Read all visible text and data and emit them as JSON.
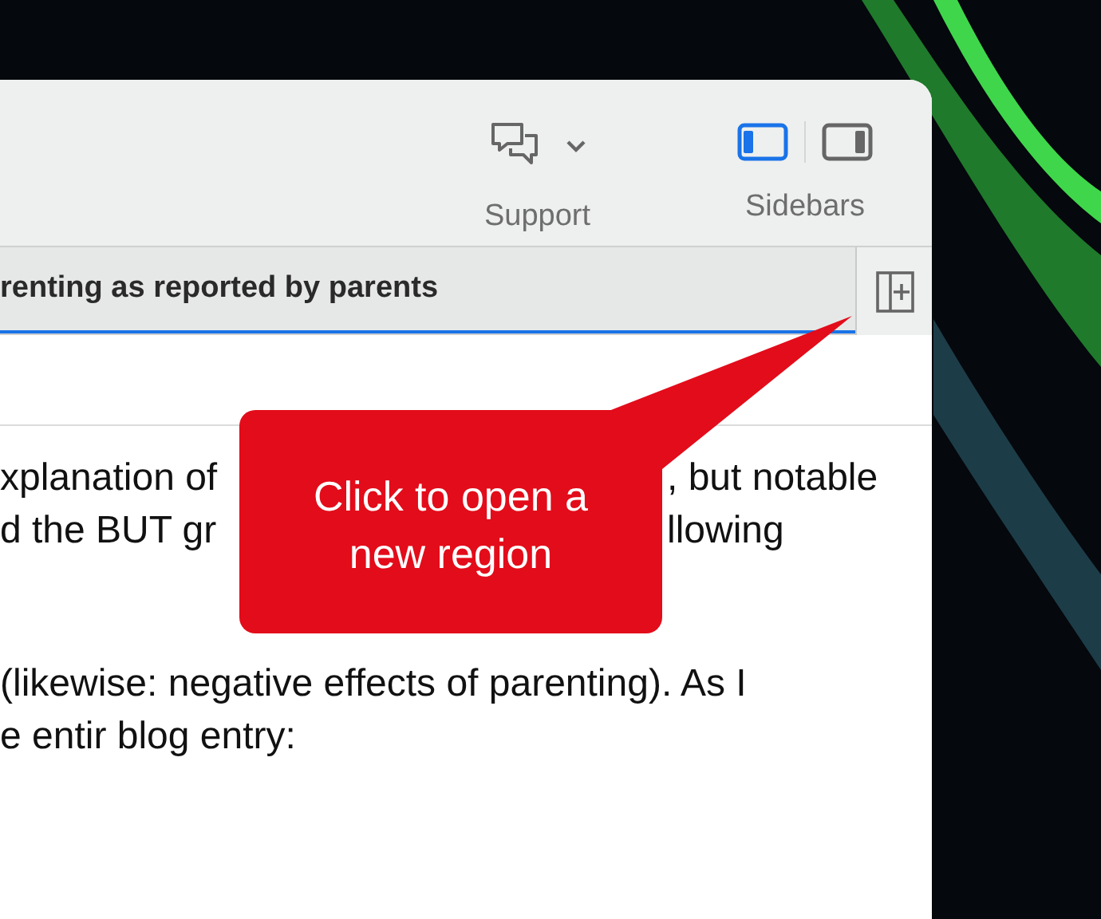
{
  "toolbar": {
    "support": {
      "label": "Support"
    },
    "sidebars": {
      "label": "Sidebars",
      "toggles": [
        {
          "kind": "left",
          "selected": true
        },
        {
          "kind": "right",
          "selected": false
        }
      ]
    }
  },
  "tab": {
    "title": "renting as reported by parents",
    "selected": true
  },
  "paragraphs": [
    [
      [
        "xplanation of",
        ", but notable"
      ],
      [
        "d the BUT gr",
        "llowing"
      ]
    ],
    [
      [
        "(likewise: negative effects of parenting). As I"
      ],
      [
        "e entir blog entry:"
      ]
    ]
  ],
  "callout": {
    "text": "Click to open a new region"
  }
}
